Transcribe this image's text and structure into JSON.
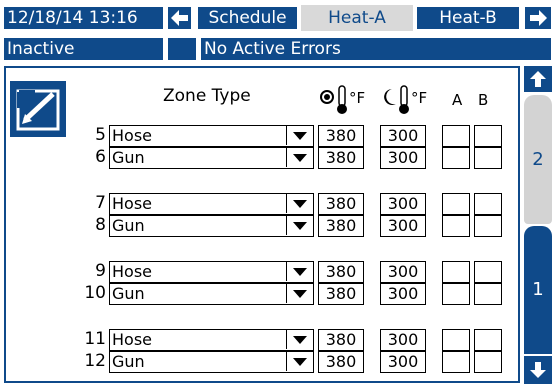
{
  "header": {
    "datetime": "12/18/14 13:16",
    "tabs": [
      {
        "label": "Schedule",
        "active": false
      },
      {
        "label": "Heat-A",
        "active": true
      },
      {
        "label": "Heat-B",
        "active": false
      }
    ]
  },
  "status": {
    "state": "Inactive",
    "errors": "No Active Errors"
  },
  "columns": {
    "zone_type": "Zone Type",
    "setpoint_unit": "°F",
    "lowtemp_unit": "°F",
    "a": "A",
    "b": "B"
  },
  "zones": [
    {
      "num": "5",
      "type": "Hose",
      "setpoint": "380",
      "low": "300"
    },
    {
      "num": "6",
      "type": "Gun",
      "setpoint": "380",
      "low": "300"
    },
    {
      "num": "7",
      "type": "Hose",
      "setpoint": "380",
      "low": "300"
    },
    {
      "num": "8",
      "type": "Gun",
      "setpoint": "380",
      "low": "300"
    },
    {
      "num": "9",
      "type": "Hose",
      "setpoint": "380",
      "low": "300"
    },
    {
      "num": "10",
      "type": "Gun",
      "setpoint": "380",
      "low": "300"
    },
    {
      "num": "11",
      "type": "Hose",
      "setpoint": "380",
      "low": "300"
    },
    {
      "num": "12",
      "type": "Gun",
      "setpoint": "380",
      "low": "300"
    }
  ],
  "pager": {
    "page2": "2",
    "page1": "1"
  },
  "colors": {
    "primary": "#0f4a8a",
    "inactive_tab": "#d9d9d9",
    "sidebar_inactive": "#d3d3d3"
  }
}
